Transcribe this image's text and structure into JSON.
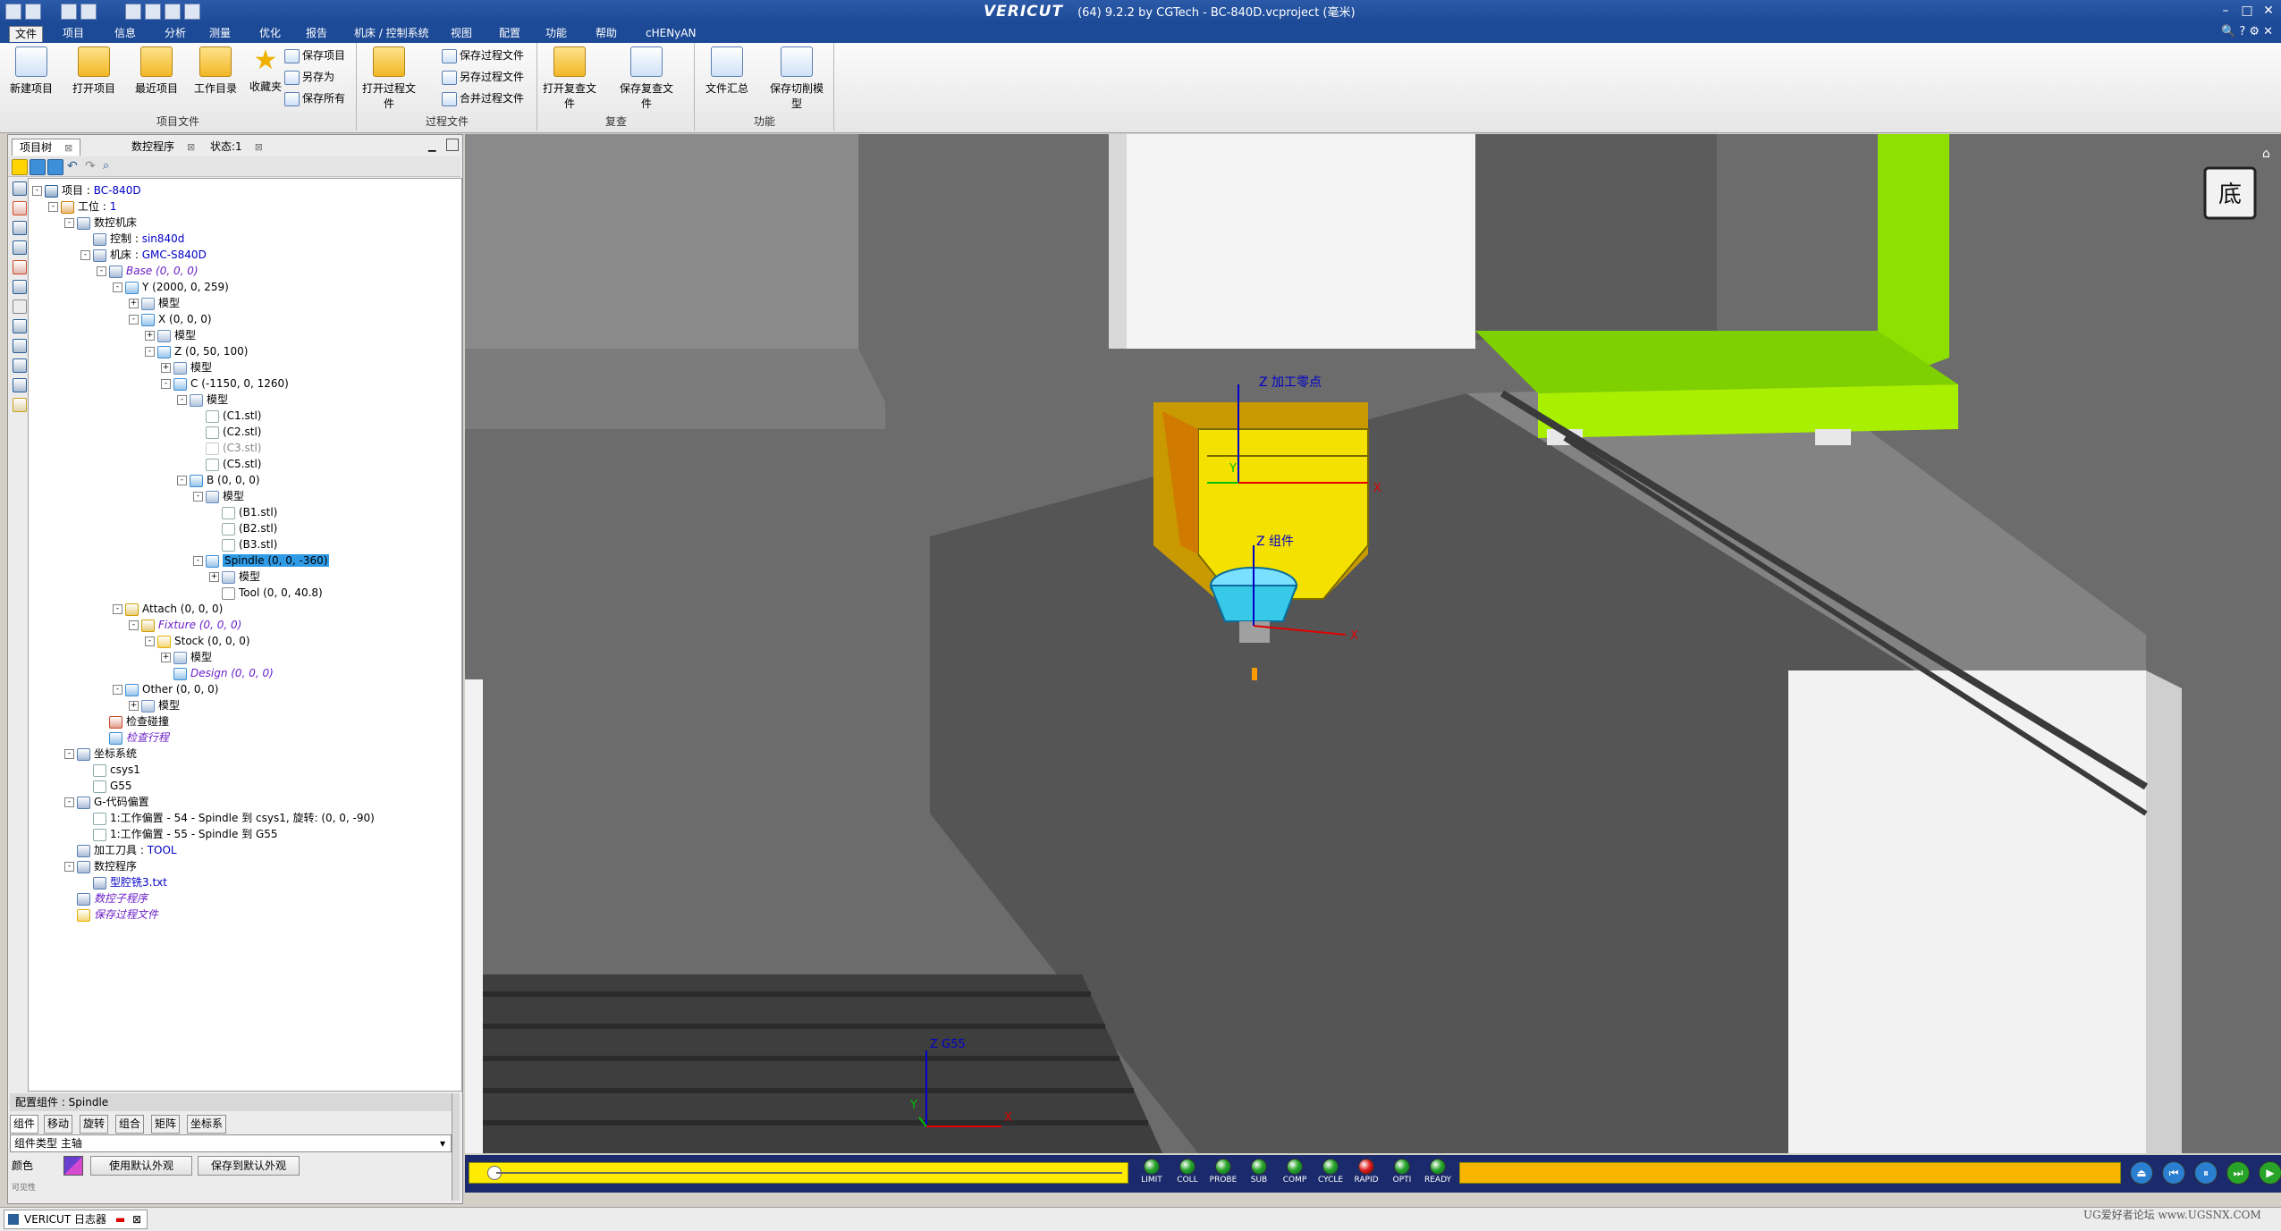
{
  "window": {
    "app_name": "VERICUT",
    "title_rest": "(64)  9.2.2 by CGTech - BC-840D.vcproject (毫米)",
    "quick_icons": [
      "save-icon",
      "open-icon",
      "undo-icon",
      "layout-icon"
    ]
  },
  "menu": [
    "文件",
    "项目",
    "信息",
    "分析",
    "测量",
    "优化",
    "报告",
    "机床 / 控制系统",
    "视图",
    "配置",
    "功能",
    "帮助",
    "cHENyAN"
  ],
  "ribbon": {
    "groups": [
      {
        "label": "项目文件",
        "big": [
          "新建项目",
          "打开项目",
          "最近项目",
          "工作目录",
          "收藏夹"
        ],
        "small": [
          "保存项目",
          "另存为",
          "保存所有"
        ]
      },
      {
        "label": "过程文件",
        "big": [
          "打开过程文件"
        ],
        "small": [
          "保存过程文件",
          "另存过程文件",
          "合并过程文件"
        ]
      },
      {
        "label": "复查",
        "big": [
          "打开复查文件",
          "保存复查文件"
        ],
        "small": []
      },
      {
        "label": "功能",
        "big": [
          "文件汇总",
          "保存切削模型"
        ],
        "small": []
      }
    ]
  },
  "left_panel": {
    "tabs": [
      "项目树",
      "数控程序",
      "状态:1"
    ],
    "tree": [
      {
        "d": 0,
        "t": "项目 : ",
        "v": "BC-840D",
        "vc": "blue",
        "tog": "-"
      },
      {
        "d": 1,
        "t": "工位 : ",
        "v": "1",
        "vc": "blue",
        "tog": "-"
      },
      {
        "d": 2,
        "t": "数控机床",
        "v": "",
        "tog": "-"
      },
      {
        "d": 3,
        "t": "控制 : ",
        "v": "sin840d",
        "vc": "blue",
        "tog": ""
      },
      {
        "d": 3,
        "t": "机床 : ",
        "v": "GMC-S840D",
        "vc": "blue",
        "tog": "-"
      },
      {
        "d": 4,
        "t": "",
        "v": "Base (0, 0, 0)",
        "vc": "purple",
        "tog": "-"
      },
      {
        "d": 5,
        "t": "Y (2000, 0, 259)",
        "v": "",
        "tog": "-"
      },
      {
        "d": 6,
        "t": "模型",
        "v": "",
        "tog": "+"
      },
      {
        "d": 6,
        "t": "X (0, 0, 0)",
        "v": "",
        "tog": "-"
      },
      {
        "d": 7,
        "t": "模型",
        "v": "",
        "tog": "+"
      },
      {
        "d": 7,
        "t": "Z (0, 50, 100)",
        "v": "",
        "tog": "-"
      },
      {
        "d": 8,
        "t": "模型",
        "v": "",
        "tog": "+"
      },
      {
        "d": 8,
        "t": "C (-1150, 0, 1260)",
        "v": "",
        "tog": "-"
      },
      {
        "d": 9,
        "t": "模型",
        "v": "",
        "tog": "-"
      },
      {
        "d": 10,
        "t": "(C1.stl)",
        "v": "",
        "tog": ""
      },
      {
        "d": 10,
        "t": "(C2.stl)",
        "v": "",
        "tog": ""
      },
      {
        "d": 10,
        "t": "",
        "v": "(C3.stl)",
        "vc": "gray",
        "tog": ""
      },
      {
        "d": 10,
        "t": "(C5.stl)",
        "v": "",
        "tog": ""
      },
      {
        "d": 9,
        "t": "B (0, 0, 0)",
        "v": "",
        "tog": "-"
      },
      {
        "d": 10,
        "t": "模型",
        "v": "",
        "tog": "-"
      },
      {
        "d": 11,
        "t": "(B1.stl)",
        "v": "",
        "tog": ""
      },
      {
        "d": 11,
        "t": "(B2.stl)",
        "v": "",
        "tog": ""
      },
      {
        "d": 11,
        "t": "(B3.stl)",
        "v": "",
        "tog": ""
      },
      {
        "d": 10,
        "t": "",
        "v": "Spindle (0, 0, -360)",
        "vc": "sel",
        "tog": "-"
      },
      {
        "d": 11,
        "t": "模型",
        "v": "",
        "tog": "+"
      },
      {
        "d": 11,
        "t": "Tool (0, 0, 40.8)",
        "v": "",
        "tog": ""
      },
      {
        "d": 5,
        "t": "Attach (0, 0, 0)",
        "v": "",
        "tog": "-"
      },
      {
        "d": 6,
        "t": "",
        "v": "Fixture (0, 0, 0)",
        "vc": "purple",
        "tog": "-"
      },
      {
        "d": 7,
        "t": "Stock (0, 0, 0)",
        "v": "",
        "tog": "-"
      },
      {
        "d": 8,
        "t": "模型",
        "v": "",
        "tog": "+"
      },
      {
        "d": 8,
        "t": "",
        "v": "Design (0, 0, 0)",
        "vc": "purple",
        "tog": ""
      },
      {
        "d": 5,
        "t": "Other (0, 0, 0)",
        "v": "",
        "tog": "-"
      },
      {
        "d": 6,
        "t": "模型",
        "v": "",
        "tog": "+"
      },
      {
        "d": 4,
        "t": "检查碰撞",
        "v": "",
        "tog": ""
      },
      {
        "d": 4,
        "t": "",
        "v": "检查行程",
        "vc": "purple",
        "tog": ""
      },
      {
        "d": 2,
        "t": "坐标系统",
        "v": "",
        "tog": "-"
      },
      {
        "d": 3,
        "t": "csys1",
        "v": "",
        "tog": ""
      },
      {
        "d": 3,
        "t": "G55",
        "v": "",
        "tog": ""
      },
      {
        "d": 2,
        "t": "G-代码偏置",
        "v": "",
        "tog": "-"
      },
      {
        "d": 3,
        "t": "1:工作偏置 - 54 - Spindle 到 csys1, 旋转: (0, 0, -90)",
        "v": "",
        "tog": ""
      },
      {
        "d": 3,
        "t": "1:工作偏置 - 55 - Spindle 到 G55",
        "v": "",
        "tog": ""
      },
      {
        "d": 2,
        "t": "加工刀具 : ",
        "v": "TOOL",
        "vc": "blue",
        "tog": ""
      },
      {
        "d": 2,
        "t": "数控程序",
        "v": "",
        "tog": "-"
      },
      {
        "d": 3,
        "t": "",
        "v": "型腔铣3.txt",
        "vc": "blue",
        "tog": ""
      },
      {
        "d": 2,
        "t": "",
        "v": "数控子程序",
        "vc": "purple",
        "tog": ""
      },
      {
        "d": 2,
        "t": "",
        "v": "保存过程文件",
        "vc": "purple",
        "tog": ""
      }
    ],
    "config": {
      "title": "配置组件 : Spindle",
      "tabs": [
        "组件",
        "移动",
        "旋转",
        "组合",
        "矩阵",
        "坐标系"
      ],
      "type_label": "组件类型",
      "type_value": "主轴",
      "color_label": "颜色",
      "btn_default": "使用默认外观",
      "btn_save_default": "保存到默认外观",
      "extra_label": "可见性"
    }
  },
  "viewport": {
    "view_cube_label": "底",
    "labels": {
      "z_work_zero": "Z 加工零点",
      "z_component": "Z 组件",
      "z_g55": "Z G55"
    },
    "axes": {
      "x": "X",
      "y": "Y"
    }
  },
  "playback": {
    "leds": [
      {
        "label": "LIMIT",
        "color": "#28a428"
      },
      {
        "label": "COLL",
        "color": "#28a428"
      },
      {
        "label": "PROBE",
        "color": "#28a428"
      },
      {
        "label": "SUB",
        "color": "#28a428"
      },
      {
        "label": "COMP",
        "color": "#28a428"
      },
      {
        "label": "CYCLE",
        "color": "#28a428"
      },
      {
        "label": "RAPID",
        "color": "#e02020"
      },
      {
        "label": "OPTI",
        "color": "#28a428"
      },
      {
        "label": "READY",
        "color": "#28a428"
      }
    ],
    "controls": [
      "rewind-icon",
      "step-back-icon",
      "pause-icon",
      "step-forward-icon",
      "play-icon"
    ]
  },
  "logbar": {
    "label": "VERICUT 日志器"
  },
  "watermark": "UG爱好者论坛 www.UGSNX.COM",
  "colors": {
    "accent": "#1d4a96",
    "selection": "#2f9be6",
    "yellow_part": "#f5e100",
    "green_machine": "#8ee000"
  }
}
